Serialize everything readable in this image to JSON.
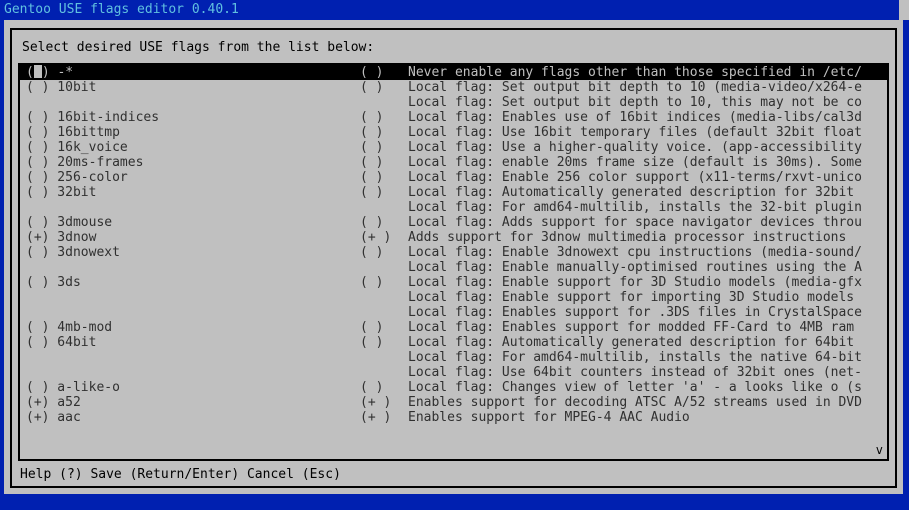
{
  "title": "Gentoo USE flags editor 0.40.1",
  "prompt": "Select desired USE flags from the list below:",
  "help_bar": "Help (?) Save (Return/Enter) Cancel (Esc)",
  "scroll": {
    "top": "#",
    "bottom": "v"
  },
  "cols": [
    "left_state",
    "flag_name",
    "mid_state",
    "description"
  ],
  "rows": [
    {
      "l": "( )",
      "name": "-*",
      "m": "(   )",
      "d": "Never enable any flags other than those specified in /etc/",
      "sel": true
    },
    {
      "l": "( )",
      "name": "10bit",
      "m": "(   )",
      "d": "Local flag: Set output bit depth to 10 (media-video/x264-e"
    },
    {
      "l": "",
      "name": "",
      "m": "",
      "d": "Local flag: Set output bit depth to 10, this may not be co"
    },
    {
      "l": "( )",
      "name": "16bit-indices",
      "m": "(   )",
      "d": "Local flag: Enables use of 16bit indices (media-libs/cal3d"
    },
    {
      "l": "( )",
      "name": "16bittmp",
      "m": "(   )",
      "d": "Local flag: Use 16bit temporary files (default 32bit float"
    },
    {
      "l": "( )",
      "name": "16k_voice",
      "m": "(   )",
      "d": "Local flag: Use a higher-quality voice. (app-accessibility"
    },
    {
      "l": "( )",
      "name": "20ms-frames",
      "m": "(   )",
      "d": "Local flag: enable 20ms frame size (default is 30ms). Some"
    },
    {
      "l": "( )",
      "name": "256-color",
      "m": "(   )",
      "d": "Local flag: Enable 256 color support (x11-terms/rxvt-unico"
    },
    {
      "l": "( )",
      "name": "32bit",
      "m": "(   )",
      "d": "Local flag: Automatically generated description for 32bit"
    },
    {
      "l": "",
      "name": "",
      "m": "",
      "d": "Local flag: For amd64-multilib, installs the 32-bit plugin"
    },
    {
      "l": "( )",
      "name": "3dmouse",
      "m": "(   )",
      "d": "Local flag: Adds support for space navigator devices throu"
    },
    {
      "l": "(+)",
      "name": "3dnow",
      "m": "(+  )",
      "d": "Adds support for 3dnow multimedia processor instructions"
    },
    {
      "l": "( )",
      "name": "3dnowext",
      "m": "(   )",
      "d": "Local flag: Enable 3dnowext cpu instructions (media-sound/"
    },
    {
      "l": "",
      "name": "",
      "m": "",
      "d": "Local flag: Enable manually-optimised routines using the A"
    },
    {
      "l": "( )",
      "name": "3ds",
      "m": "(   )",
      "d": "Local flag: Enable support for 3D Studio models (media-gfx"
    },
    {
      "l": "",
      "name": "",
      "m": "",
      "d": "Local flag: Enable support for importing 3D Studio models"
    },
    {
      "l": "",
      "name": "",
      "m": "",
      "d": "Local flag: Enables support for .3DS files in CrystalSpace"
    },
    {
      "l": "( )",
      "name": "4mb-mod",
      "m": "(   )",
      "d": "Local flag: Enables support for modded FF-Card to 4MB ram"
    },
    {
      "l": "( )",
      "name": "64bit",
      "m": "(   )",
      "d": "Local flag: Automatically generated description for 64bit"
    },
    {
      "l": "",
      "name": "",
      "m": "",
      "d": "Local flag: For amd64-multilib, installs the native 64-bit"
    },
    {
      "l": "",
      "name": "",
      "m": "",
      "d": "Local flag: Use 64bit counters instead of 32bit ones (net-"
    },
    {
      "l": "( )",
      "name": "a-like-o",
      "m": "(   )",
      "d": "Local flag: Changes view of letter 'a' - a looks like o (s"
    },
    {
      "l": "(+)",
      "name": "a52",
      "m": "(+  )",
      "d": "Enables support for decoding ATSC A/52 streams used in DVD"
    },
    {
      "l": "(+)",
      "name": "aac",
      "m": "(+  )",
      "d": "Enables support for MPEG-4 AAC Audio"
    }
  ]
}
